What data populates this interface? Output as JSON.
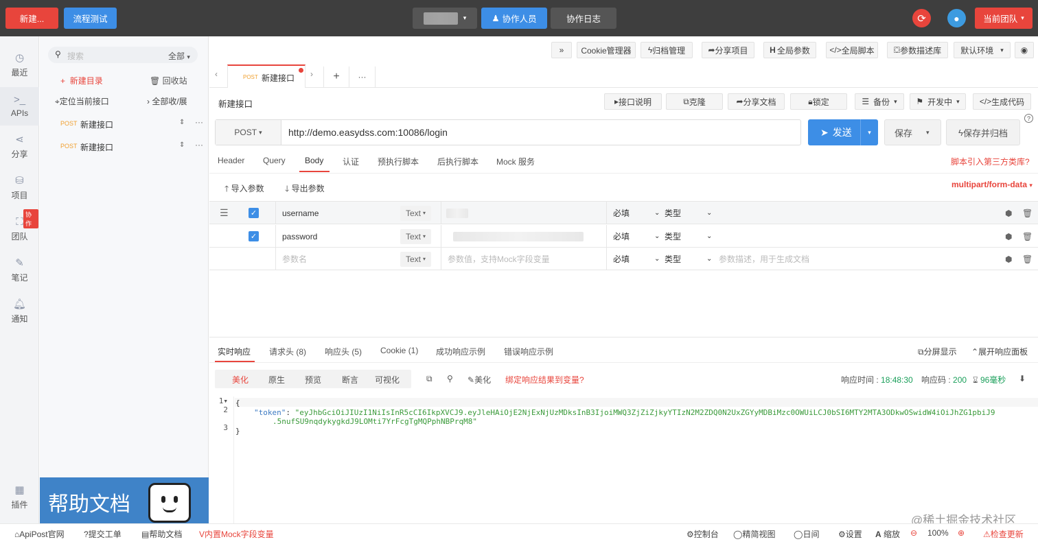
{
  "topbar": {
    "new_label": "新建...",
    "flow_test": "流程测试",
    "collab_people": "协作人员",
    "collab_log": "协作日志",
    "current_team": "当前团队"
  },
  "nav": [
    {
      "icon": "clock-icon",
      "label": "最近"
    },
    {
      "icon": "terminal-icon",
      "label": "APIs"
    },
    {
      "icon": "share-icon",
      "label": "分享"
    },
    {
      "icon": "project-icon",
      "label": "项目"
    },
    {
      "icon": "team-icon",
      "label": "团队",
      "badge": "协作"
    },
    {
      "icon": "note-icon",
      "label": "笔记"
    },
    {
      "icon": "bell-icon",
      "label": "通知"
    },
    {
      "icon": "plugin-icon",
      "label": "插件"
    }
  ],
  "tree": {
    "search_placeholder": "搜索",
    "filter": "全部",
    "new_dir": "新建目录",
    "recycle": "回收站",
    "locate": "定位当前接口",
    "collapse": "全部收/展",
    "items": [
      {
        "method": "POST",
        "name": "新建接口"
      },
      {
        "method": "POST",
        "name": "新建接口"
      }
    ],
    "help_banner": "帮助文档"
  },
  "toolbar": {
    "more": "»",
    "cookie": "Cookie管理器",
    "archive": "归档管理",
    "share_project": "分享项目",
    "global_params": "全局参数",
    "global_script": "全局脚本",
    "param_desc": "参数描述库",
    "env": "默认环境"
  },
  "tabs": {
    "active_method": "POST",
    "active_name": "新建接口",
    "add": "+",
    "more": "···"
  },
  "api": {
    "name": "新建接口",
    "desc": "接口说明",
    "clone": "克隆",
    "share_doc": "分享文档",
    "lock": "锁定",
    "backup": "备份",
    "status": "开发中",
    "gen_code": "生成代码"
  },
  "request": {
    "method": "POST",
    "url": "http://demo.easydss.com:10086/login",
    "send": "发送",
    "save": "保存",
    "save_archive": "保存并归档"
  },
  "req_tabs": [
    "Header",
    "Query",
    "Body",
    "认证",
    "预执行脚本",
    "后执行脚本",
    "Mock 服务"
  ],
  "req_tab_active": "Body",
  "script_link": "脚本引入第三方类库?",
  "body": {
    "import": "导入参数",
    "export": "导出参数",
    "content_type": "multipart/form-data",
    "rows": [
      {
        "name": "username",
        "type": "Text",
        "required": "必填",
        "dtype": "类型",
        "desc": ""
      },
      {
        "name": "password",
        "type": "Text",
        "required": "必填",
        "dtype": "类型",
        "desc": ""
      }
    ],
    "new_row": {
      "name_ph": "参数名",
      "type": "Text",
      "value_ph": "参数值，支持Mock字段变量",
      "required": "必填",
      "dtype": "类型",
      "desc_ph": "参数描述，用于生成文档"
    }
  },
  "resp_tabs": [
    "实时响应",
    "请求头 (8)",
    "响应头 (5)",
    "Cookie (1)",
    "成功响应示例",
    "错误响应示例"
  ],
  "resp_tab_active": "实时响应",
  "resp_right": {
    "split": "分屏显示",
    "expand": "展开响应面板"
  },
  "view_modes": [
    "美化",
    "原生",
    "预览",
    "断言",
    "可视化"
  ],
  "view_active": "美化",
  "resp_tools": {
    "beautify": "美化",
    "bind": "绑定响应结果到变量?",
    "time_label": "响应时间 : ",
    "time": "18:48:30",
    "code_label": "响应码 : ",
    "code": "200",
    "duration": "96毫秒"
  },
  "code": {
    "l1": "{",
    "l2_key": "\"token\"",
    "l2_val": "\"eyJhbGciOiJIUzI1NiIsInR5cCI6IkpXVCJ9.eyJleHAiOjE2NjExNjUzMDksInB3IjoiMWQ3ZjZiZjkyYTIzN2M2ZDQ0N2UxZGYyMDBiMzc0OWUiLCJ0bSI6MTY2MTA3ODkwOSwidW4iOiJhZG1pbiJ9",
    "l2_val2": ".5nufSU9nqdykygkdJ9LOMti7YrFcgTgMQPphNBPrqM8\"",
    "l3": "}"
  },
  "footer": {
    "site": "ApiPost官网",
    "ticket": "提交工单",
    "help": "帮助文档",
    "mock": "内置Mock字段变量",
    "console": "控制台",
    "compact": "精简视图",
    "day": "日间",
    "settings": "设置",
    "zoom_label": "缩放",
    "zoom": "100%",
    "update": "检查更新",
    "watermark": "@稀土掘金技术社区"
  }
}
